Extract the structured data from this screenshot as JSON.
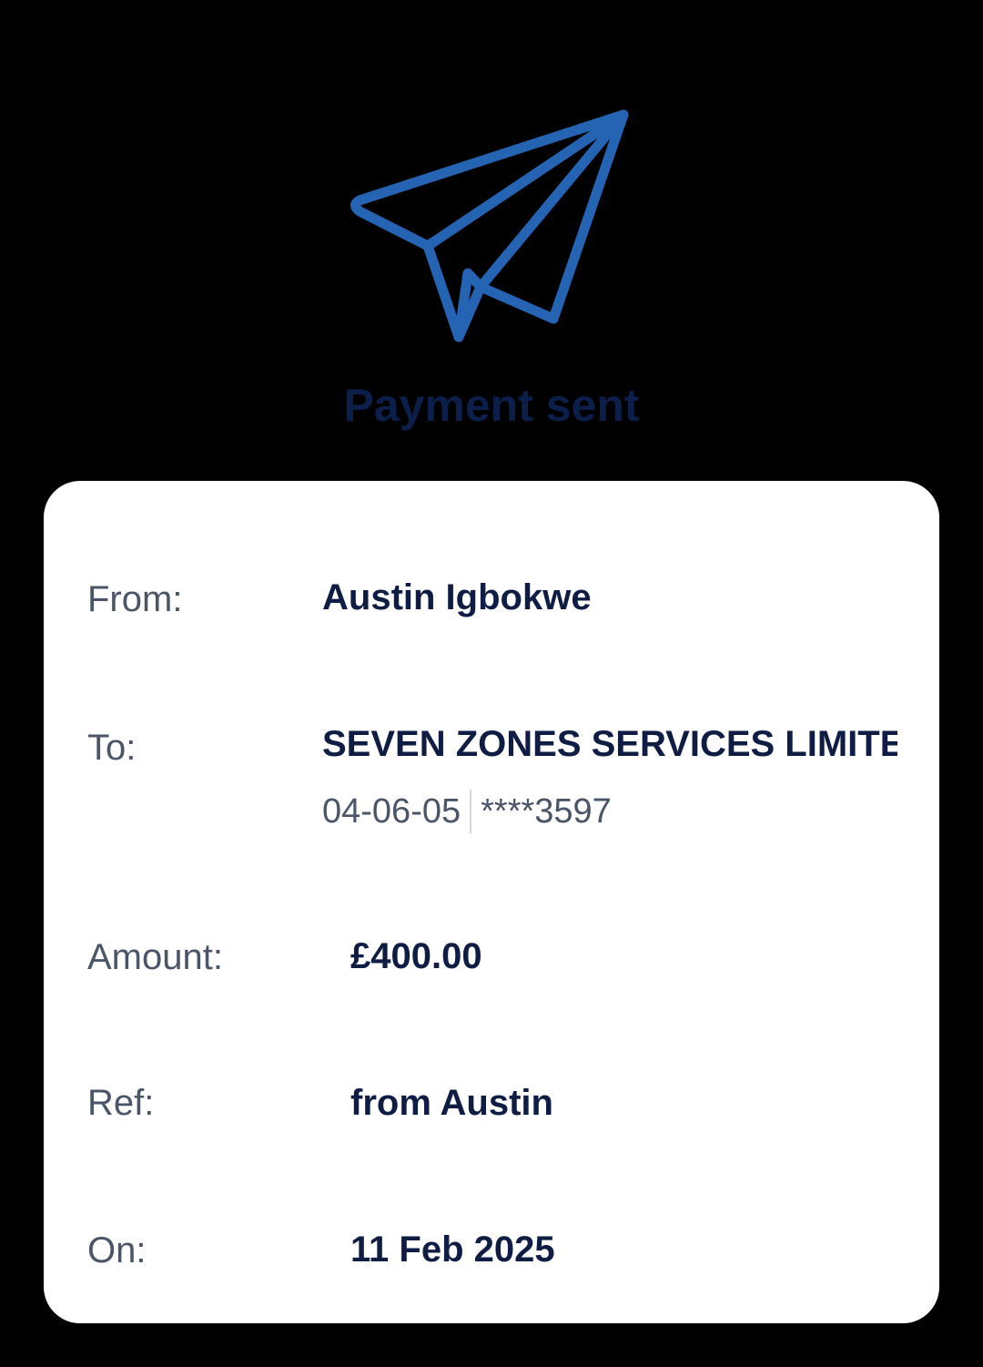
{
  "header": {
    "icon": "paper-plane-icon",
    "title": "Payment sent",
    "accent_color": "#2563b3"
  },
  "details": {
    "from_label": "From:",
    "from_value": "Austin Igbokwe",
    "to_label": "To:",
    "to_value": "SEVEN ZONES SERVICES LIMITE",
    "sort_code": "04-06-05",
    "account_masked": "****3597",
    "amount_label": "Amount:",
    "amount_value": "£400.00",
    "ref_label": "Ref:",
    "ref_value": "from Austin",
    "on_label": "On:",
    "on_value": "11 Feb 2025"
  }
}
